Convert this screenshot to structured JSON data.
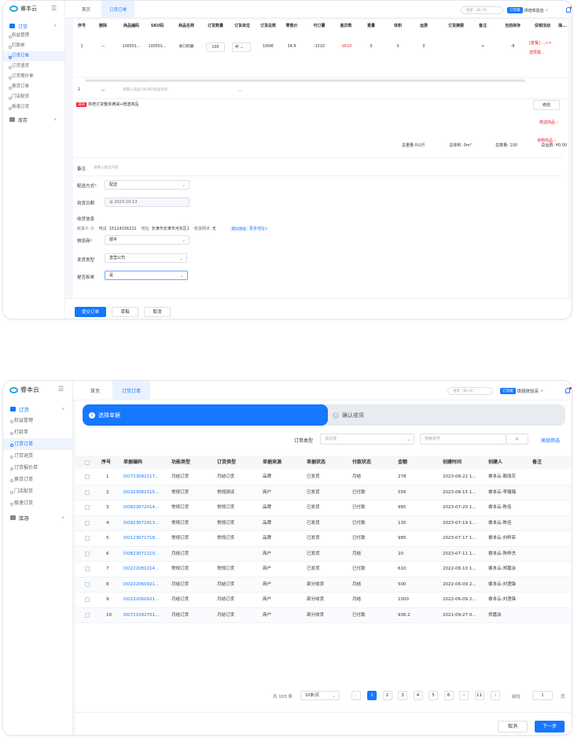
{
  "app": {
    "brand": "睿本云",
    "collapse_icon": "menu-fold-icon"
  },
  "menu": {
    "group_order": "订货",
    "items": [
      "权益管理",
      "打款单",
      "订货订单",
      "订货退货",
      "订货报价单",
      "换货订单",
      "门店配货",
      "极速订货"
    ],
    "group_stock": "库存"
  },
  "top": {
    "home": "首页",
    "tab": "订货订单",
    "search_placeholder": "搜索（录+K）",
    "store_badge": "订货端",
    "store": "烘焙体验店",
    "store_caret": "∨"
  },
  "order": {
    "columns": [
      "序号",
      "删除",
      "商品编码",
      "SKU码",
      "商品名称",
      "订货数量",
      "订货单位",
      "订货总数",
      "零售价",
      "可订量",
      "差异数",
      "重量",
      "体积",
      "运费",
      "订货摘要",
      "备注",
      "当前库存",
      "促销活动",
      "操..."
    ],
    "row": {
      "seq": "1",
      "del": "—",
      "code": "100501...",
      "sku": "100501...",
      "name": "进口奶酪",
      "qty": "100",
      "unit": "杯",
      "total": "100杯",
      "price": "34.9",
      "avail": "-1510",
      "diff": "-1610",
      "weight": "0",
      "volume": "0",
      "freight": "0",
      "summary": "",
      "remark": "+",
      "stock": "-8",
      "promo": "[套餐] ...>>",
      "promo2": "选择套..."
    },
    "row2": {
      "seq": "2",
      "del": "—",
      "placeholder": "请输入商品/SKU码/商品名称",
      "more": "..."
    },
    "tag": "满减",
    "tag_text": "烘焙订货整单满减+赠送商品",
    "modify": "修改",
    "gift": "赠送商品 ›",
    "pending": "待赠商品 ›",
    "totals": {
      "weight": "总重量:0公斤",
      "volume": "总体积: 0m³",
      "count": "总数量: 100",
      "freight": "总运费: ¥0.00"
    },
    "remark_label": "备注",
    "remark_placeholder": "请输入备注内容",
    "delivery_label": "配送方式",
    "delivery": "配送",
    "date_label": "到货日期",
    "date": "2023-10-13",
    "receiver_title": "收货信息",
    "receiver": "收货人 小",
    "phone_label": "电话",
    "phone": "15124156221",
    "addr_label": "地址",
    "addr": "天津市天津市河东区1",
    "site_label": "收货网点",
    "site": "无",
    "default_tag": "默认地址",
    "more_addr": "更多地址",
    "logistics_label": "物流商",
    "logistics": "顺丰",
    "ship_label": "发货类型",
    "ship": "直营公司",
    "split_label": "是否拆单",
    "split": "是",
    "submit": "提交订单",
    "draft": "草稿",
    "cancel": "取消"
  },
  "receipt": {
    "step1": "选择单据",
    "step1_num": "1",
    "step2": "确认收货",
    "step2_num": "2",
    "filter_label": "订单类型",
    "filter_placeholder": "请选择",
    "search_placeholder": "搜索单号",
    "advanced": "高级筛选",
    "columns": [
      "序号",
      "单据编码",
      "功能类型",
      "订货类型",
      "单据来源",
      "单据状态",
      "付款状态",
      "金额",
      "创建时间",
      "创建人",
      "备注"
    ],
    "rows": [
      [
        "1",
        "DO723082217...",
        "月结订货",
        "月结订货",
        "品牌",
        "已发货",
        "月结",
        "278",
        "2023-08-22 1...",
        "睿本云-赖丽花",
        ""
      ],
      [
        "2",
        "DO323081515...",
        "常规订货",
        "常规测试",
        "商户",
        "已发货",
        "已付款",
        "556",
        "2023-08-15 1...",
        "睿本云-李璐璐",
        ""
      ],
      [
        "3",
        "DO823072014...",
        "常规订货",
        "常规订货",
        "品牌",
        "已发货",
        "已付款",
        "985",
        "2023-07-20 1...",
        "睿本云-陈佳",
        ""
      ],
      [
        "4",
        "DO923071913...",
        "常规订货",
        "常规订货",
        "品牌",
        "已发货",
        "已付款",
        "135",
        "2023-07-19 1...",
        "睿本云-陈佳",
        ""
      ],
      [
        "5",
        "DO123071718...",
        "常规订货",
        "常规订货",
        "品牌",
        "已发货",
        "已付款",
        "985",
        "2023-07-17 1...",
        "睿本云-刘梓菲",
        ""
      ],
      [
        "6",
        "DO823071110...",
        "月结订货",
        "",
        "商户",
        "已发货",
        "月结",
        "20",
        "2023-07-11 1...",
        "睿本云-陈梓杰",
        ""
      ],
      [
        "7",
        "DO222081014...",
        "常规订货",
        "常规订货",
        "商户",
        "已发货",
        "已付款",
        "610",
        "2022-08-10 1...",
        "睿本云-郑嘉泳",
        ""
      ],
      [
        "8",
        "DO222060921...",
        "月结订货",
        "月结订货",
        "商户",
        "部分收货",
        "月结",
        "500",
        "2022-06-09 2...",
        "睿本云-刘澄锋",
        ""
      ],
      [
        "9",
        "DO222060921...",
        "月结订货",
        "月结订货",
        "商户",
        "部分收货",
        "月结",
        "1000",
        "2022-06-09 2...",
        "睿本云-刘澄锋",
        ""
      ],
      [
        "10",
        "DO721092701...",
        "月结订货",
        "月结订货",
        "商户",
        "部分收货",
        "已付款",
        "936.2",
        "2021-09-27 0...",
        "郑嘉泳",
        ""
      ]
    ],
    "total": "共 103 条",
    "page_size": "10条/页",
    "pages": [
      "1",
      "2",
      "3",
      "4",
      "5",
      "6",
      "···",
      "11"
    ],
    "goto_label": "前往",
    "goto_value": "1",
    "page_unit": "页",
    "cancel": "取消",
    "next": "下一步"
  }
}
